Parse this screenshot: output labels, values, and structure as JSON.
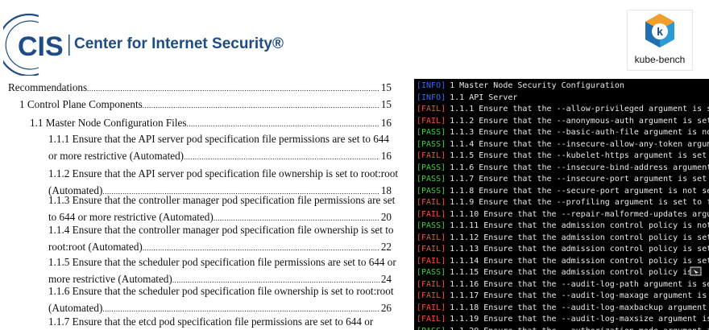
{
  "header": {
    "cis_abbrev": "CIS",
    "cis_name": "Center for Internet Security®",
    "kube_bench_label": "kube-bench",
    "kube_bench_letter": "k"
  },
  "colors": {
    "cis_blue": "#1d4c86",
    "info": "#2d6bff",
    "fail": "#ff4d3a",
    "pass": "#3ad23a",
    "terminal_bg": "#000000"
  },
  "toc": [
    {
      "lines": [
        "Recommendations"
      ],
      "page": "15"
    },
    {
      "lines": [
        "1 Control Plane Components"
      ],
      "page": "15"
    },
    {
      "lines": [
        "1.1 Master Node Configuration Files"
      ],
      "page": "16"
    },
    {
      "lines": [
        "1.1.1 Ensure that the API server pod specification file permissions are set to 644",
        "or more restrictive (Automated)"
      ],
      "page": "16"
    },
    {
      "lines": [
        "1.1.2 Ensure that the API server pod specification file ownership is set to root:root",
        "(Automated)"
      ],
      "page": "18"
    },
    {
      "lines": [
        "1.1.3 Ensure that the controller manager pod specification file permissions are set",
        "to 644 or more restrictive (Automated)"
      ],
      "page": "20"
    },
    {
      "lines": [
        "1.1.4 Ensure that the controller manager pod specification file ownership is set to",
        "root:root (Automated)"
      ],
      "page": "22"
    },
    {
      "lines": [
        "1.1.5 Ensure that the scheduler pod specification file permissions are set to 644 or",
        "more restrictive (Automated)"
      ],
      "page": "24"
    },
    {
      "lines": [
        "1.1.6 Ensure that the scheduler pod specification file ownership is set to root:root",
        "(Automated)"
      ],
      "page": "26"
    },
    {
      "lines": [
        "1.1.7 Ensure that the etcd pod specification file permissions are set to 644 or"
      ],
      "page": ""
    }
  ],
  "terminal": [
    {
      "tag": "[INFO]",
      "status": "info",
      "text": "1 Master Node Security Configuration"
    },
    {
      "tag": "[INFO]",
      "status": "info",
      "text": "1.1 API Server"
    },
    {
      "tag": "[FAIL]",
      "status": "fail",
      "text": "1.1.1 Ensure that the --allow-privileged argument is se"
    },
    {
      "tag": "[FAIL]",
      "status": "fail",
      "text": "1.1.2 Ensure that the --anonymous-auth argument is set"
    },
    {
      "tag": "[PASS]",
      "status": "pass",
      "text": "1.1.3 Ensure that the --basic-auth-file argument is not"
    },
    {
      "tag": "[PASS]",
      "status": "pass",
      "text": "1.1.4 Ensure that the --insecure-allow-any-token argume"
    },
    {
      "tag": "[FAIL]",
      "status": "fail",
      "text": "1.1.5 Ensure that the --kubelet-https argument is set t"
    },
    {
      "tag": "[PASS]",
      "status": "pass",
      "text": "1.1.6 Ensure that the --insecure-bind-address argument"
    },
    {
      "tag": "[PASS]",
      "status": "pass",
      "text": "1.1.7 Ensure that the --insecure-port argument is set t"
    },
    {
      "tag": "[PASS]",
      "status": "pass",
      "text": "1.1.8 Ensure that the --secure-port argument is not set"
    },
    {
      "tag": "[FAIL]",
      "status": "fail",
      "text": "1.1.9 Ensure that the --profiling argument is set to fa"
    },
    {
      "tag": "[FAIL]",
      "status": "fail",
      "text": "1.1.10 Ensure that the --repair-malformed-updates argum"
    },
    {
      "tag": "[PASS]",
      "status": "pass",
      "text": "1.1.11 Ensure that the admission control policy is not"
    },
    {
      "tag": "[FAIL]",
      "status": "fail",
      "text": "1.1.12 Ensure that the admission control policy is set"
    },
    {
      "tag": "[FAIL]",
      "status": "fail",
      "text": "1.1.13 Ensure that the admission control policy is set"
    },
    {
      "tag": "[FAIL]",
      "status": "fail",
      "text": "1.1.14 Ensure that the admission control policy is set"
    },
    {
      "tag": "[PASS]",
      "status": "pass",
      "text": "1.1.15 Ensure that the admission control policy is"
    },
    {
      "tag": "[FAIL]",
      "status": "fail",
      "text": "1.1.16 Ensure that the --audit-log-path argument is set"
    },
    {
      "tag": "[FAIL]",
      "status": "fail",
      "text": "1.1.17 Ensure that the --audit-log-maxage argument is s"
    },
    {
      "tag": "[FAIL]",
      "status": "fail",
      "text": "1.1.18 Ensure that the --audit-log-maxbackup argument i"
    },
    {
      "tag": "[FAIL]",
      "status": "fail",
      "text": "1.1.19 Ensure that the --audit-log-maxsize argument is"
    },
    {
      "tag": "[PASS]",
      "status": "pass",
      "text": "1.1.20 Ensure that the --authorization-mode argument is"
    }
  ]
}
